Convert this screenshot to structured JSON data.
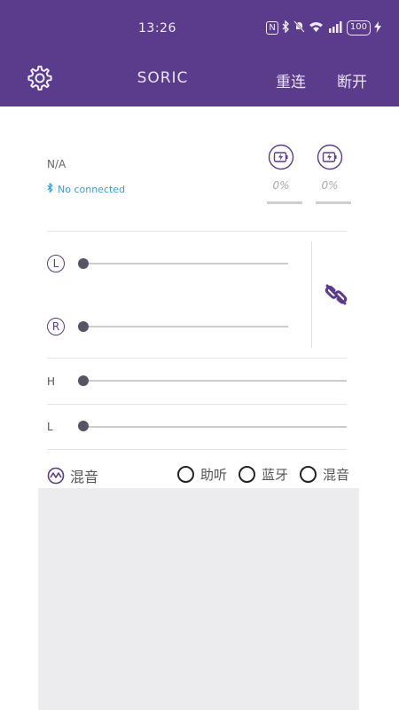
{
  "status_bar": {
    "time": "13:26",
    "nfc_icon": "N",
    "battery": "100"
  },
  "toolbar": {
    "title": "SORIC",
    "reconnect": "重连",
    "disconnect": "断开"
  },
  "device": {
    "name": "N/A",
    "connection": "No connected"
  },
  "battery": {
    "left_percent": "0%",
    "right_percent": "0%",
    "left_level": 0,
    "right_level": 0
  },
  "sliders": {
    "left_label": "L",
    "right_label": "R",
    "high_label": "H",
    "low_label": "L",
    "left_value": 0,
    "right_value": 0,
    "high_value": 0,
    "low_value": 0
  },
  "mode": {
    "current": "混音",
    "options": [
      "助听",
      "蓝牙",
      "混音"
    ]
  },
  "colors": {
    "header": "#5b3b8c",
    "accent": "#5b3b8c",
    "bluetooth": "#3aa0d8",
    "panel": "#ececee"
  },
  "icons": {
    "settings": "gear-icon",
    "bluetooth": "bluetooth-icon",
    "battery": "battery-charging-icon",
    "link": "unlink-icon",
    "mode": "waveform-icon"
  }
}
